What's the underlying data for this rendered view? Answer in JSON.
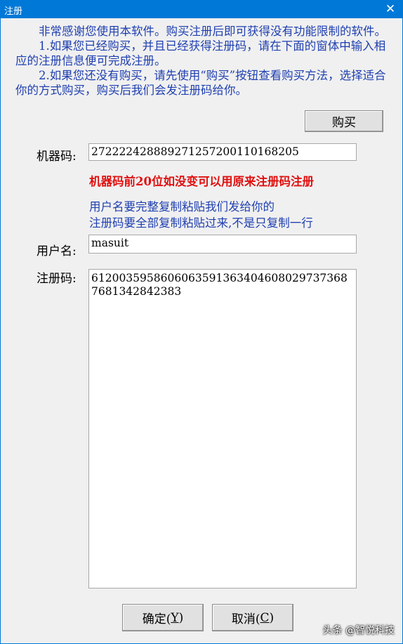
{
  "window": {
    "title": "注册",
    "close_glyph": "✕"
  },
  "intro": {
    "paragraph1": "非常感谢您使用本软件。购买注册后即可获得没有功能限制的软件。",
    "paragraph2": "1.如果您已经购买，并且已经获得注册码，请在下面的窗体中输入相应的注册信息便可完成注册。",
    "paragraph3": "2.如果您还没有购买，请先使用“购买”按钮查看购买方法，选择适合你的方式购买，购买后我们会发注册码给你。"
  },
  "buy_button": {
    "label": "购买"
  },
  "machine_code": {
    "label": "机器码:",
    "value": "272222428889271257200110168205"
  },
  "warning": "机器码前20位如没变可以用原来注册码注册",
  "hints": {
    "line1": "用户名要完整复制粘贴我们发给你的",
    "line2": "注册码要全部复制粘贴过来,不是只复制一行"
  },
  "username": {
    "label": "用户名:",
    "value": "masuit"
  },
  "reg_code": {
    "label": "注册码:",
    "value": "6120035958606063591363404608029737368 7681342842383"
  },
  "ok_button": {
    "label_prefix": "确定(",
    "accel": "Y",
    "label_suffix": ")"
  },
  "cancel_button": {
    "label_prefix": "取消(",
    "accel": "C",
    "label_suffix": ")"
  },
  "watermark": "头条 @智悦科技"
}
